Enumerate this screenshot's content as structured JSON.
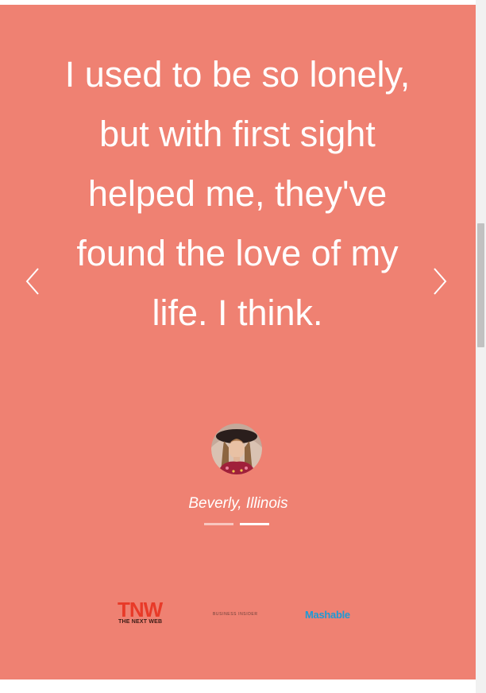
{
  "testimonial": {
    "quote": "I used to be so lonely, but with first sight helped me, they've found the love of my life. I think.",
    "author": "Beverly, Illinois",
    "avatar_icon": "woman-portrait",
    "prev_icon": "chevron-left-icon",
    "next_icon": "chevron-right-icon",
    "pagination": {
      "count": 2,
      "active_index": 2
    },
    "background_color": "#ef8172"
  },
  "press": {
    "tnw": {
      "logo": "TNW",
      "subtitle": "THE NEXT WEB"
    },
    "business_insider": "BUSINESS INSIDER",
    "mashable": "Mashable"
  },
  "colors": {
    "tnw_red": "#e83a28",
    "mashable_blue": "#1d9ad6",
    "text_white": "#ffffff"
  }
}
